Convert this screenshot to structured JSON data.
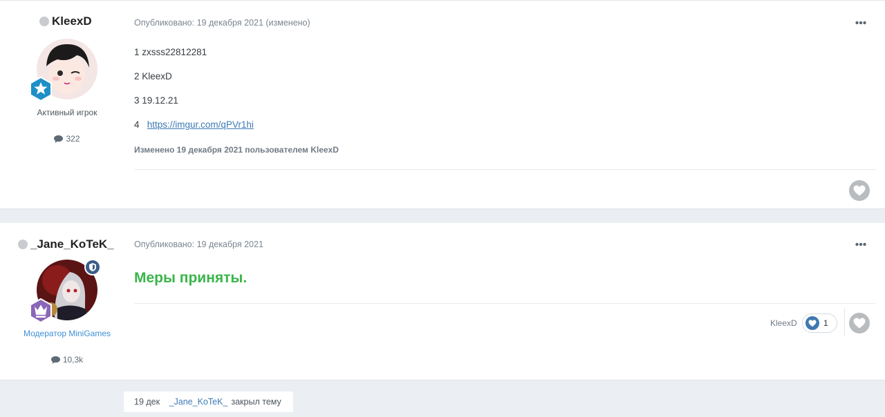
{
  "posts": [
    {
      "author": {
        "name": "KleexD",
        "group": "Активный игрок",
        "group_color": "#4d565e",
        "post_count": "322",
        "online": false
      },
      "meta": "Опубликовано: 19 декабря 2021 (изменено)",
      "lines": [
        {
          "number": "1",
          "text": "zxsss22812281"
        },
        {
          "number": "2",
          "text": "KleexD"
        },
        {
          "number": "3",
          "text": "19.12.21"
        },
        {
          "number": "4",
          "link": "https://imgur.com/qPVr1hi"
        }
      ],
      "edited_note": "Изменено 19 декабря 2021 пользователем KleexD"
    },
    {
      "author": {
        "name": "_Jane_KoTeK_",
        "group": "Модератор MiniGames",
        "group_color": "#3d8ed4",
        "post_count": "10,3k",
        "online": false
      },
      "meta": "Опубликовано: 19 декабря 2021",
      "message": "Меры приняты.",
      "message_color": "#39b54a",
      "reaction": {
        "user": "KleexD",
        "count": "1"
      }
    }
  ],
  "mod_action": {
    "date": "19 дек",
    "user": "_Jane_KoTeK_",
    "action": "закрыл тему"
  },
  "icons": {
    "like": "heart-icon",
    "comment": "comment-icon",
    "menu": "ellipsis-icon",
    "rank_1": "star-badge-icon",
    "rank_2": "crown-badge-icon",
    "mod": "shield-icon"
  }
}
